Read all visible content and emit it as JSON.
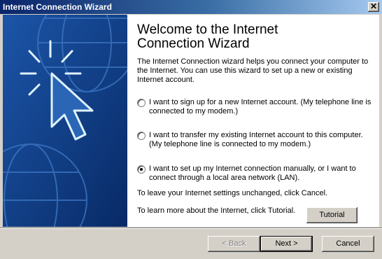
{
  "window": {
    "title": "Internet Connection Wizard"
  },
  "heading": "Welcome to the Internet\nConnection Wizard",
  "intro": "The Internet Connection wizard helps you connect your computer to the Internet.  You can use this wizard to set up a new or existing Internet account.",
  "options": [
    {
      "label": "I want to sign up for a new Internet account. (My telephone line is connected to my modem.)",
      "selected": false
    },
    {
      "label": "I want to transfer my existing Internet account to this computer. (My telephone line is connected to my modem.)",
      "selected": false
    },
    {
      "label": "I want to set up my Internet connection manually, or I want to connect through a local area network (LAN).",
      "selected": true
    }
  ],
  "cancel_note": "To leave your Internet settings unchanged, click Cancel.",
  "tutorial_note": "To learn more about the Internet, click Tutorial.",
  "buttons": {
    "tutorial": "Tutorial",
    "back": "< Back",
    "next": "Next >",
    "cancel": "Cancel"
  },
  "colors": {
    "titlebar": "#0a246a",
    "art_background": "#0a3a84",
    "dialog_face": "#d4d0c8"
  },
  "icons": {
    "close": "close-icon"
  }
}
